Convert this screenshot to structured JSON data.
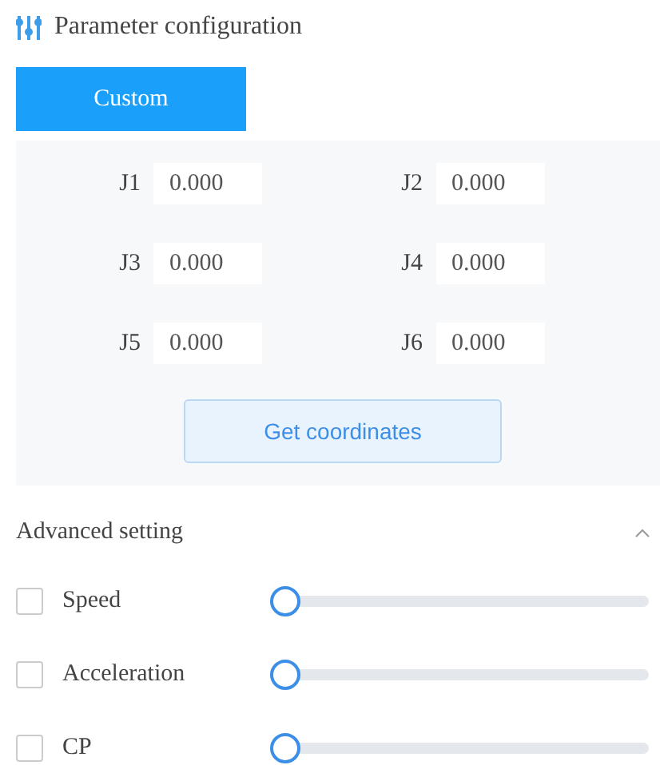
{
  "header": {
    "title": "Parameter configuration"
  },
  "tabs": [
    {
      "label": "Custom",
      "selected": true
    }
  ],
  "joints": [
    {
      "label": "J1",
      "value": "0.000"
    },
    {
      "label": "J2",
      "value": "0.000"
    },
    {
      "label": "J3",
      "value": "0.000"
    },
    {
      "label": "J4",
      "value": "0.000"
    },
    {
      "label": "J5",
      "value": "0.000"
    },
    {
      "label": "J6",
      "value": "0.000"
    }
  ],
  "get_button": "Get coordinates",
  "advanced": {
    "title": "Advanced setting",
    "expanded": true,
    "settings": [
      {
        "label": "Speed",
        "checked": false,
        "level": 0
      },
      {
        "label": "Acceleration",
        "checked": false,
        "level": 0
      },
      {
        "label": "CP",
        "checked": false,
        "level": 0
      }
    ]
  }
}
